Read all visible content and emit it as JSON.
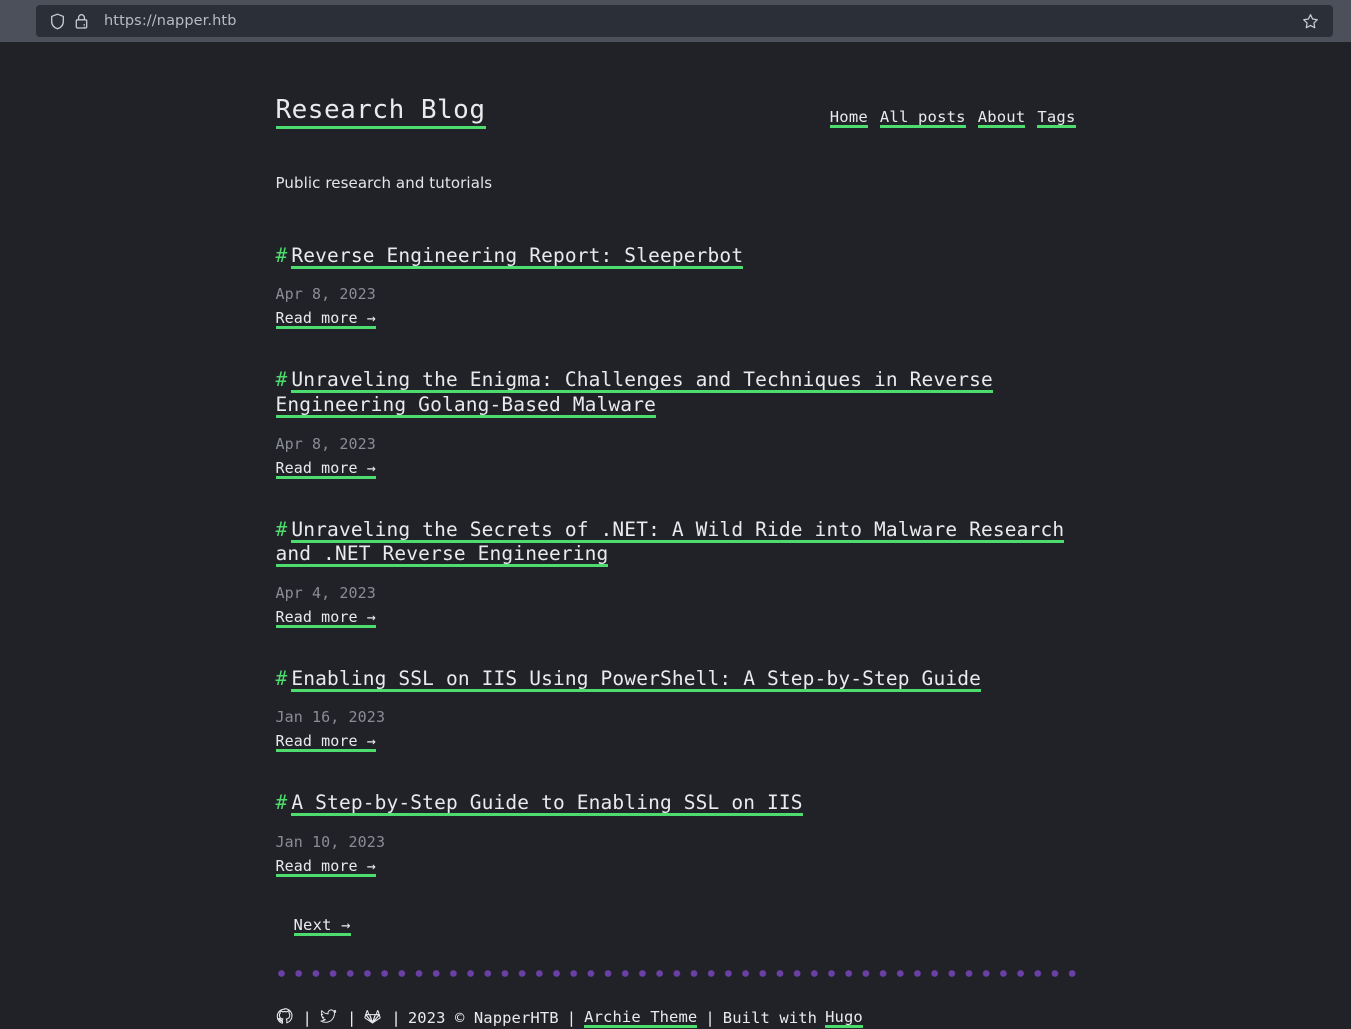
{
  "browser": {
    "url": "https://napper.htb",
    "shield_icon": "shield-icon",
    "lock_warning_icon": "lock-warning-icon",
    "bookmark_icon": "star-icon"
  },
  "header": {
    "site_title": "Research Blog",
    "nav": [
      {
        "label": "Home"
      },
      {
        "label": "All posts"
      },
      {
        "label": "About"
      },
      {
        "label": "Tags"
      }
    ],
    "tagline": "Public research and tutorials"
  },
  "posts": [
    {
      "hash": "#",
      "title": "Reverse Engineering Report: Sleeperbot",
      "date": "Apr 8, 2023",
      "read_more": "Read more →"
    },
    {
      "hash": "#",
      "title": "Unraveling the Enigma: Challenges and Techniques in Reverse Engineering Golang-Based Malware",
      "date": "Apr 8, 2023",
      "read_more": "Read more →"
    },
    {
      "hash": "#",
      "title": "Unraveling the Secrets of .NET: A Wild Ride into Malware Research and .NET Reverse Engineering",
      "date": "Apr 4, 2023",
      "read_more": "Read more →"
    },
    {
      "hash": "#",
      "title": "Enabling SSL on IIS Using PowerShell: A Step-by-Step Guide",
      "date": "Jan 16, 2023",
      "read_more": "Read more →"
    },
    {
      "hash": "#",
      "title": "A Step-by-Step Guide to Enabling SSL on IIS",
      "date": "Jan 10, 2023",
      "read_more": "Read more →"
    }
  ],
  "pagination": {
    "next_label": "Next →"
  },
  "footer": {
    "social": [
      {
        "name": "github-icon"
      },
      {
        "name": "twitter-icon"
      },
      {
        "name": "gitlab-icon"
      }
    ],
    "separator": "|",
    "copyright": "2023 © NapperHTB",
    "theme_label": "Archie Theme",
    "built_with": "Built with",
    "generator": "Hugo",
    "dot_color": "#6a3fa6"
  },
  "colors": {
    "background": "#212227",
    "accent_green": "#4ddd6e",
    "text": "#e9eaec",
    "muted_text": "#8a8d94",
    "chrome": "#4b505a",
    "urlbar": "#2b2f38"
  }
}
